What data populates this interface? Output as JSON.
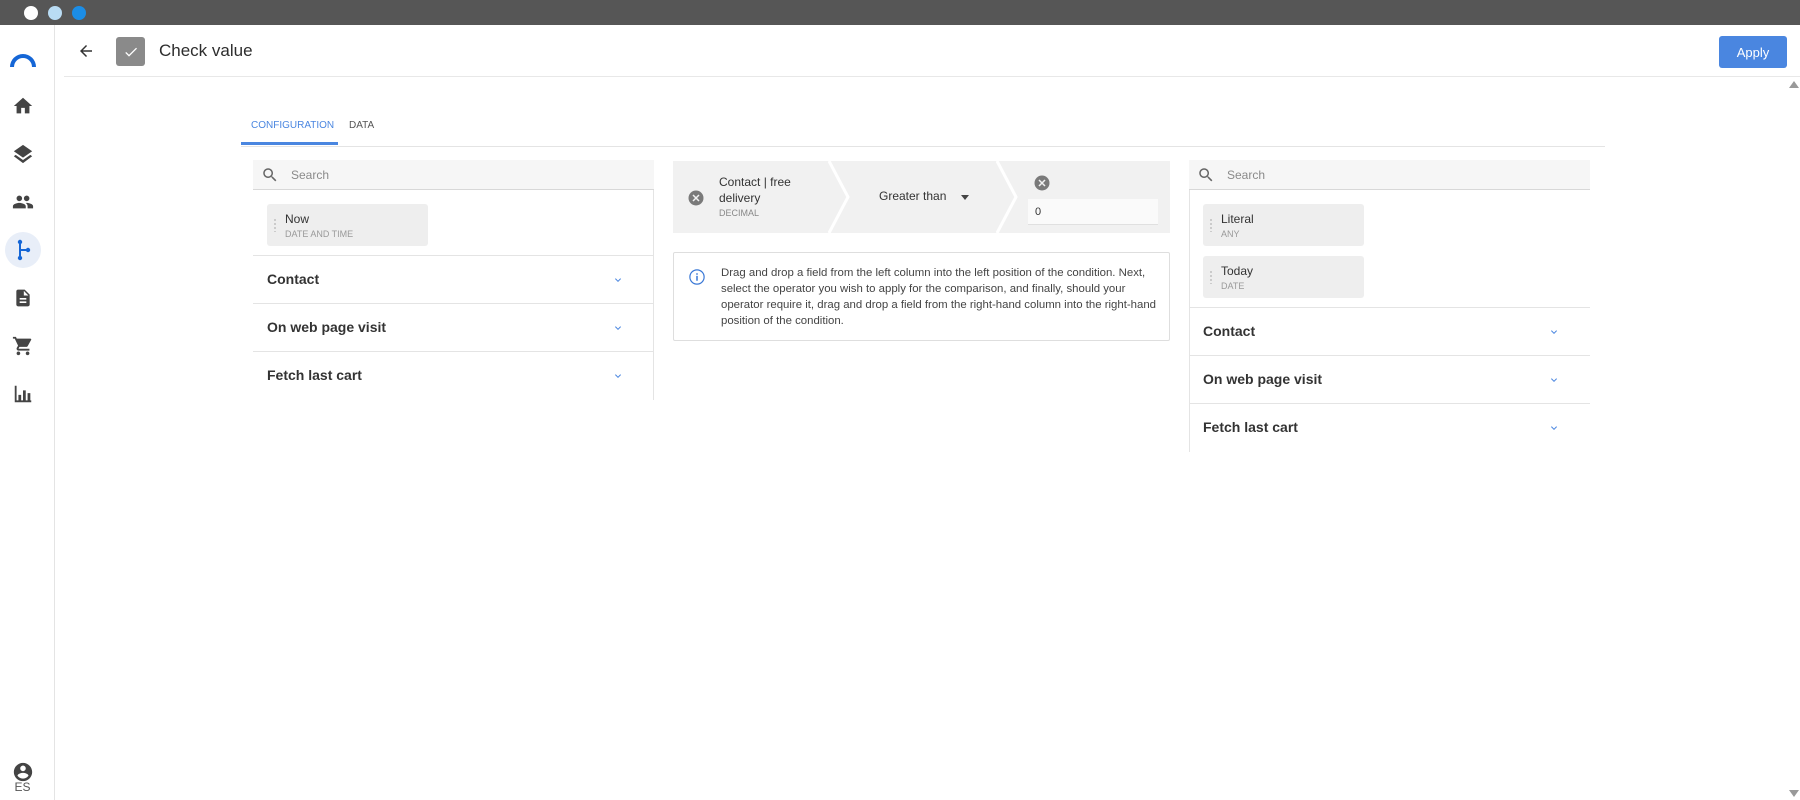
{
  "window": {
    "dots": [
      {
        "name": "close-dot",
        "color": "#ffffff"
      },
      {
        "name": "minimize-dot",
        "color": "#b9dcf4"
      },
      {
        "name": "maximize-dot",
        "color": "#1b8de6"
      }
    ]
  },
  "sidebar": {
    "items": [
      {
        "name": "logo-icon"
      },
      {
        "name": "home-icon"
      },
      {
        "name": "layers-icon"
      },
      {
        "name": "people-icon"
      },
      {
        "name": "workflow-icon",
        "active": true
      },
      {
        "name": "document-icon"
      },
      {
        "name": "cart-icon"
      },
      {
        "name": "bar-chart-icon"
      }
    ],
    "user_icon": "account-circle-icon",
    "language": "ES"
  },
  "header": {
    "title": "Check value",
    "icon": "check-icon",
    "apply_label": "Apply"
  },
  "tabs": [
    {
      "label": "CONFIGURATION",
      "active": true
    },
    {
      "label": "DATA",
      "active": false
    }
  ],
  "left_column": {
    "search_placeholder": "Search",
    "chips": [
      {
        "name": "Now",
        "type": "DATE AND TIME"
      }
    ],
    "sections": [
      "Contact",
      "On web page visit",
      "Fetch last cart"
    ]
  },
  "condition": {
    "left_field": "Contact | free delivery",
    "left_type": "DECIMAL",
    "operator": "Greater than",
    "right_value": "0"
  },
  "info_text": "Drag and drop a field from the left column into the left position of the condition. Next, select the operator you wish to apply for the comparison, and finally, should your operator require it, drag and drop a field from the right-hand column into the right-hand position of the condition.",
  "right_column": {
    "search_placeholder": "Search",
    "chips": [
      {
        "name": "Literal",
        "type": "ANY"
      },
      {
        "name": "Today",
        "type": "DATE"
      }
    ],
    "sections": [
      "Contact",
      "On web page visit",
      "Fetch last cart"
    ]
  },
  "colors": {
    "accent": "#4a86e0",
    "titlebar": "#565656"
  }
}
